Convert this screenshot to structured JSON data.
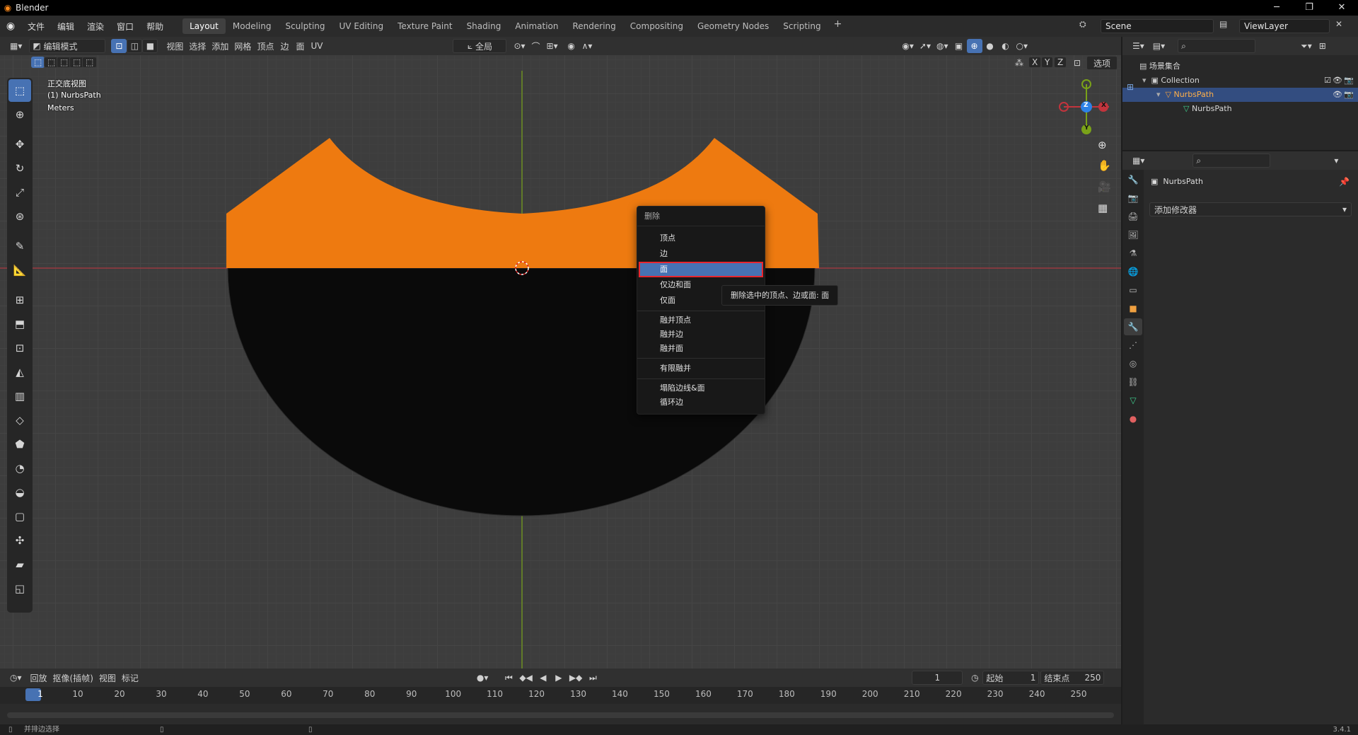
{
  "window": {
    "title": "Blender",
    "minimize": "─",
    "maximize": "❐",
    "close": "✕"
  },
  "menubar": {
    "menus": [
      "文件",
      "编辑",
      "渲染",
      "窗口",
      "帮助"
    ],
    "tabs": [
      "Layout",
      "Modeling",
      "Sculpting",
      "UV Editing",
      "Texture Paint",
      "Shading",
      "Animation",
      "Rendering",
      "Compositing",
      "Geometry Nodes",
      "Scripting"
    ],
    "active_tab": "Layout",
    "add_tab": "+",
    "scene": "Scene",
    "view_layer": "ViewLayer"
  },
  "viewport_header": {
    "mode": "编辑模式",
    "menus": [
      "视图",
      "选择",
      "添加",
      "网格",
      "顶点",
      "边",
      "面",
      "UV"
    ],
    "transform_orientation": "全局",
    "options": "选项",
    "axes": [
      "X",
      "Y",
      "Z"
    ]
  },
  "viewport_info": {
    "view_name": "正交底视图",
    "object": "(1) NurbsPath",
    "units": "Meters"
  },
  "gizmo": {
    "z": "Z",
    "y": "Y",
    "x": "X"
  },
  "context_menu": {
    "title": "删除",
    "items": [
      "顶点",
      "边",
      "面",
      "仅边和面",
      "仅面"
    ],
    "items2": [
      "融并顶点",
      "融并边",
      "融并面"
    ],
    "items3": [
      "有限融并"
    ],
    "items4": [
      "塌陷边线&面",
      "循环边"
    ],
    "highlighted": "面"
  },
  "tooltip": "删除选中的顶点、边或面: 面",
  "outliner": {
    "root": "场景集合",
    "collection": "Collection",
    "object": "NurbsPath",
    "mesh": "NurbsPath"
  },
  "properties": {
    "object_name": "NurbsPath",
    "add_modifier": "添加修改器"
  },
  "timeline": {
    "menus": [
      "回放",
      "抠像(插帧)",
      "视图",
      "标记"
    ],
    "current_frame": "1",
    "start_label": "起始",
    "start": "1",
    "end_label": "结束点",
    "end": "250",
    "ticks": [
      "1",
      "10",
      "20",
      "30",
      "40",
      "50",
      "60",
      "70",
      "80",
      "90",
      "100",
      "110",
      "120",
      "130",
      "140",
      "150",
      "160",
      "170",
      "180",
      "190",
      "200",
      "210",
      "220",
      "230",
      "240",
      "250"
    ]
  },
  "statusbar": {
    "hint": "并排边选择",
    "version": "3.4.1"
  },
  "colors": {
    "accent": "#4772b3",
    "selected_mesh": "#f07b0f",
    "highlight_outline": "#e8262e",
    "x_axis": "#c2343d",
    "y_axis": "#7aa219",
    "z_axis": "#2d82e6"
  }
}
